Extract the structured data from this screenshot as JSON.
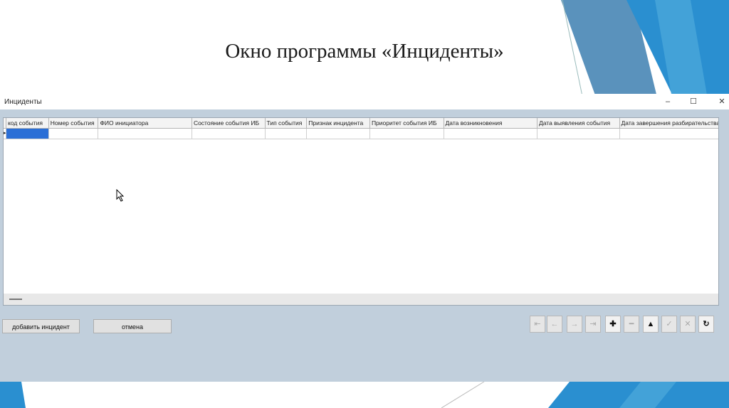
{
  "slide": {
    "title": "Окно программы «Инциденты»"
  },
  "window": {
    "title": "Инциденты",
    "controls": [
      "–",
      "☐",
      "✕"
    ]
  },
  "grid": {
    "row_indicator": "▸",
    "columns": [
      "код события",
      "Номер события",
      "ФИО инициатора",
      "Состояние события ИБ",
      "Тип события",
      "Признак инцидента",
      "Приоритет события ИБ",
      "Дата возникновения",
      "Дата выявления события",
      "Дата завершения разбирательства"
    ]
  },
  "buttons": {
    "add_incident": "добавить инцидент",
    "cancel": "отмена"
  },
  "navigator": {
    "icons": [
      "first-icon",
      "prev-icon",
      "next-icon",
      "last-icon",
      "add-icon",
      "delete-icon",
      "up-icon",
      "post-icon",
      "cancel-edit-icon",
      "refresh-icon"
    ],
    "glyphs": [
      "⇤",
      "←",
      "→",
      "⇥",
      "✚",
      "━",
      "▲",
      "✓",
      "✕",
      "↻"
    ],
    "enabled": [
      false,
      false,
      false,
      false,
      true,
      false,
      true,
      false,
      false,
      true
    ]
  },
  "colors": {
    "accent_blue": "#2a8fd0",
    "window_bg": "#c1cfdc",
    "selection": "#2b6fd6"
  }
}
